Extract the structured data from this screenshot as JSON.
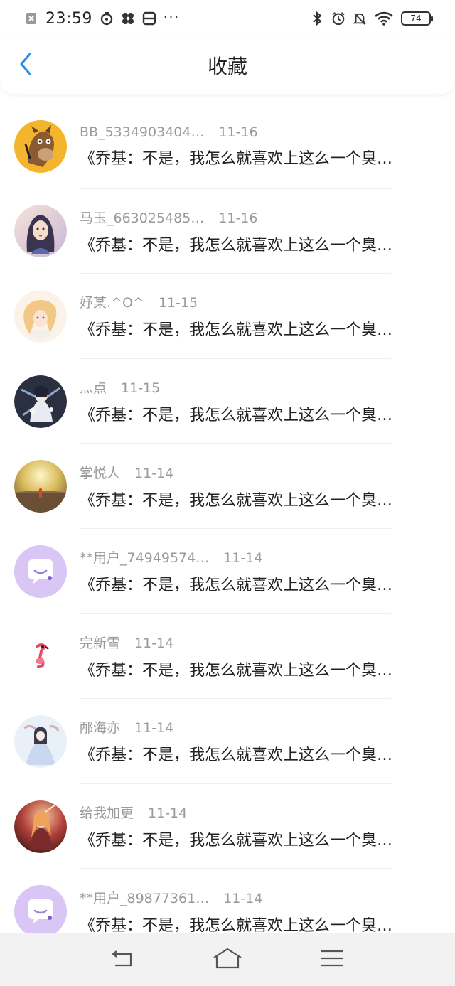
{
  "status_bar": {
    "time": "23:59",
    "dots": "···",
    "battery": "74"
  },
  "header": {
    "title": "收藏",
    "back_icon": "chevron-left-icon"
  },
  "items": [
    {
      "user": "BB_5334903404…",
      "date": "11-16",
      "excerpt": "《乔基：不是，我怎么就喜欢上这么一个臭…",
      "avatar": "horse-cartoon"
    },
    {
      "user": "马玉_663025485…",
      "date": "11-16",
      "excerpt": "《乔基：不是，我怎么就喜欢上这么一个臭…",
      "avatar": "girl-portrait"
    },
    {
      "user": "妤某.^O^",
      "date": "11-15",
      "excerpt": "《乔基：不是，我怎么就喜欢上这么一个臭…",
      "avatar": "anime-blonde"
    },
    {
      "user": "灬点",
      "date": "11-15",
      "excerpt": "《乔基：不是，我怎么就喜欢上这么一个臭…",
      "avatar": "anime-dark"
    },
    {
      "user": "掌悦人",
      "date": "11-14",
      "excerpt": "《乔基：不是，我怎么就喜欢上这么一个臭…",
      "avatar": "sunset-landscape"
    },
    {
      "user": "**用户_74949574…",
      "date": "11-14",
      "excerpt": "《乔基：不是，我怎么就喜欢上这么一个臭…",
      "avatar": "default-chat"
    },
    {
      "user": "完新雪",
      "date": "11-14",
      "excerpt": "《乔基：不是，我怎么就喜欢上这么一个臭…",
      "avatar": "flamingo"
    },
    {
      "user": "邴海亦",
      "date": "11-14",
      "excerpt": "《乔基：不是，我怎么就喜欢上这么一个臭…",
      "avatar": "anime-white-dress"
    },
    {
      "user": "给我加更",
      "date": "11-14",
      "excerpt": "《乔基：不是，我怎么就喜欢上这么一个臭…",
      "avatar": "anime-red"
    },
    {
      "user": "**用户_89877361…",
      "date": "11-14",
      "excerpt": "《乔基：不是，我怎么就喜欢上这么一个臭…",
      "avatar": "default-chat"
    }
  ],
  "nav": {
    "back_icon": "return-icon",
    "home_icon": "home-icon",
    "menu_icon": "menu-icon"
  },
  "colors": {
    "accent": "#2f8fe6",
    "meta_gray": "#9a9a9a",
    "default_avatar": "#d9c6f5"
  }
}
